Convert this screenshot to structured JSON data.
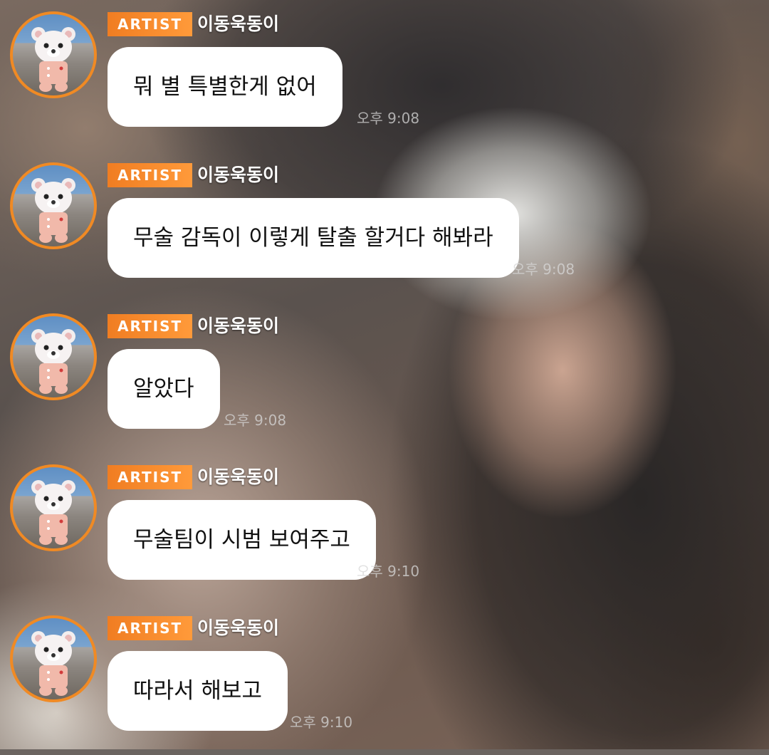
{
  "chat": {
    "messages": [
      {
        "badge": "ARTIST",
        "sender": "이동욱동이",
        "text": "뭐 별 특별한게 없어",
        "time": "오후 9:08"
      },
      {
        "badge": "ARTIST",
        "sender": "이동욱동이",
        "text": "무술 감독이 이렇게 탈출 할거다 해봐라",
        "time": "오후 9:08"
      },
      {
        "badge": "ARTIST",
        "sender": "이동욱동이",
        "text": "알았다",
        "time": "오후 9:08"
      },
      {
        "badge": "ARTIST",
        "sender": "이동욱동이",
        "text": "무술팀이 시범 보여주고",
        "time": "오후 9:10"
      },
      {
        "badge": "ARTIST",
        "sender": "이동욱동이",
        "text": "따라서 해보고",
        "time": "오후 9:10"
      }
    ]
  },
  "colors": {
    "badge": "#f07d22",
    "avatar_ring": "#f08a24",
    "bubble": "#ffffff"
  },
  "icons": {
    "avatar": "plush-bear-avatar-icon"
  }
}
